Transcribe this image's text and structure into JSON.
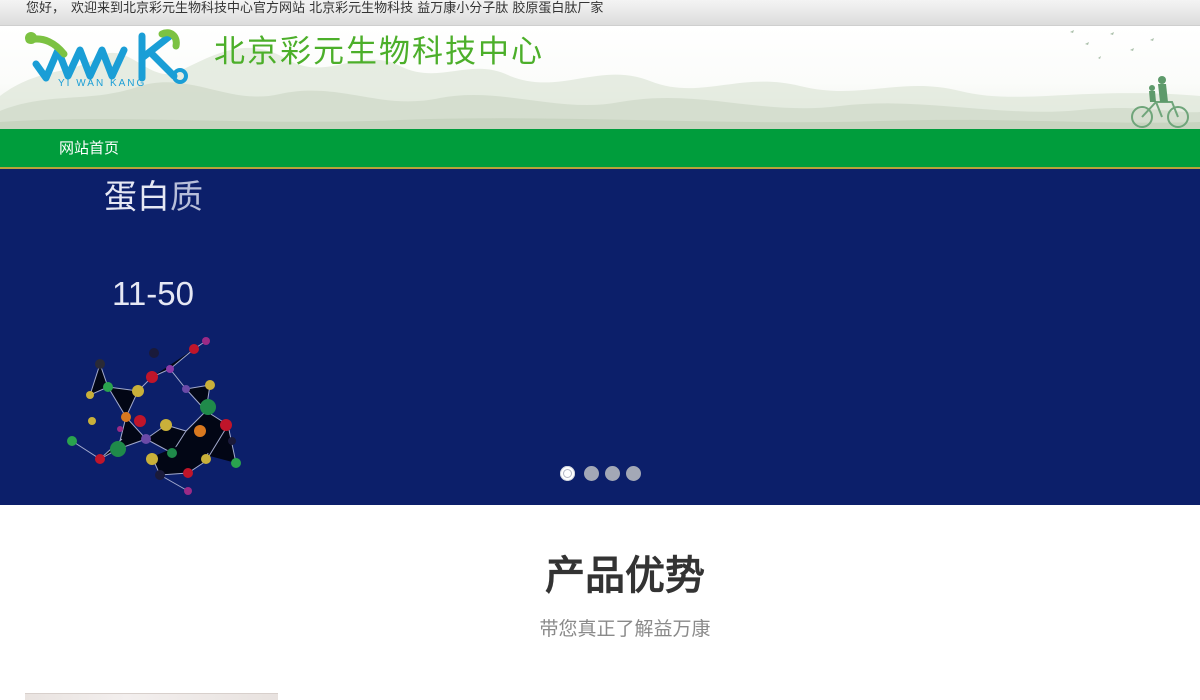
{
  "topbar": {
    "greeting": "您好，",
    "welcome": "欢迎来到北京彩元生物科技中心官方网站",
    "tagline": "北京彩元生物科技 益万康小分子肽 胶原蛋白肽厂家"
  },
  "header": {
    "logo_text": "YI WAN KANG",
    "site_title": "北京彩元生物科技中心",
    "brand_color": "#4caf2a",
    "logo_color": "#1a9ed6"
  },
  "nav": {
    "items": [
      {
        "label": "网站首页"
      }
    ],
    "bg_color": "#009d3c"
  },
  "banner": {
    "heading_main": "蛋白",
    "heading_tail": "质",
    "range": "11-50",
    "bg_color": "#0c1f6a",
    "slides": 4,
    "active_slide": 1
  },
  "section": {
    "title": "产品优势",
    "subtitle": "带您真正了解益万康"
  }
}
